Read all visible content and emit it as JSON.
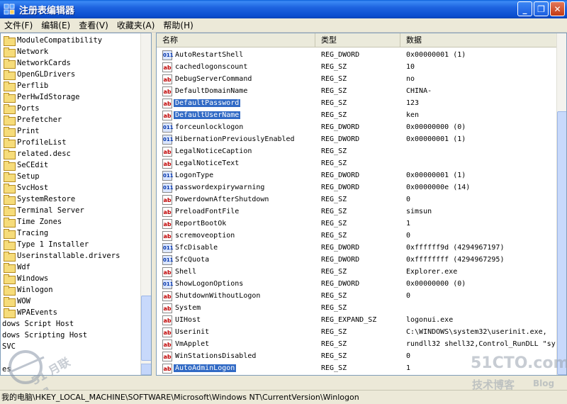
{
  "window": {
    "title": "注册表编辑器"
  },
  "menu": [
    {
      "label": "文件(F)"
    },
    {
      "label": "编辑(E)"
    },
    {
      "label": "查看(V)"
    },
    {
      "label": "收藏夹(A)"
    },
    {
      "label": "帮助(H)"
    }
  ],
  "tree": {
    "items": [
      {
        "label": "ModuleCompatibility",
        "folder": true
      },
      {
        "label": "Network",
        "folder": true
      },
      {
        "label": "NetworkCards",
        "folder": true
      },
      {
        "label": "OpenGLDrivers",
        "folder": true
      },
      {
        "label": "Perflib",
        "folder": true
      },
      {
        "label": "PerHwIdStorage",
        "folder": true
      },
      {
        "label": "Ports",
        "folder": true
      },
      {
        "label": "Prefetcher",
        "folder": true
      },
      {
        "label": "Print",
        "folder": true
      },
      {
        "label": "ProfileList",
        "folder": true
      },
      {
        "label": "related.desc",
        "folder": true
      },
      {
        "label": "SeCEdit",
        "folder": true
      },
      {
        "label": "Setup",
        "folder": true
      },
      {
        "label": "SvcHost",
        "folder": true
      },
      {
        "label": "SystemRestore",
        "folder": true
      },
      {
        "label": "Terminal Server",
        "folder": true
      },
      {
        "label": "Time Zones",
        "folder": true
      },
      {
        "label": "Tracing",
        "folder": true
      },
      {
        "label": "Type 1 Installer",
        "folder": true
      },
      {
        "label": "Userinstallable.drivers",
        "folder": true
      },
      {
        "label": "Wdf",
        "folder": true
      },
      {
        "label": "Windows",
        "folder": true
      },
      {
        "label": "Winlogon",
        "folder": true
      },
      {
        "label": "WOW",
        "folder": true
      },
      {
        "label": "WPAEvents",
        "folder": true
      },
      {
        "label": "dows Script Host",
        "folder": false
      },
      {
        "label": "dows Scripting Host",
        "folder": false
      },
      {
        "label": "SVC",
        "folder": false
      },
      {
        "label": "",
        "folder": false
      },
      {
        "label": "es",
        "folder": false
      }
    ]
  },
  "list": {
    "columns": {
      "name": "名称",
      "type": "类型",
      "data": "数据"
    },
    "rows": [
      {
        "name": "AutoRestartShell",
        "type": "REG_DWORD",
        "data": "0x00000001 (1)",
        "kind": "dw"
      },
      {
        "name": "cachedlogonscount",
        "type": "REG_SZ",
        "data": "10",
        "kind": "sz"
      },
      {
        "name": "DebugServerCommand",
        "type": "REG_SZ",
        "data": "no",
        "kind": "sz"
      },
      {
        "name": "DefaultDomainName",
        "type": "REG_SZ",
        "data": "CHINA-",
        "kind": "sz"
      },
      {
        "name": "DefaultPassword",
        "type": "REG_SZ",
        "data": "123",
        "kind": "sz",
        "selected": true
      },
      {
        "name": "DefaultUserName",
        "type": "REG_SZ",
        "data": "ken",
        "kind": "sz",
        "selected": true
      },
      {
        "name": "forceunlocklogon",
        "type": "REG_DWORD",
        "data": "0x00000000 (0)",
        "kind": "dw"
      },
      {
        "name": "HibernationPreviouslyEnabled",
        "type": "REG_DWORD",
        "data": "0x00000001 (1)",
        "kind": "dw"
      },
      {
        "name": "LegalNoticeCaption",
        "type": "REG_SZ",
        "data": "",
        "kind": "sz"
      },
      {
        "name": "LegalNoticeText",
        "type": "REG_SZ",
        "data": "",
        "kind": "sz"
      },
      {
        "name": "LogonType",
        "type": "REG_DWORD",
        "data": "0x00000001 (1)",
        "kind": "dw"
      },
      {
        "name": "passwordexpirywarning",
        "type": "REG_DWORD",
        "data": "0x0000000e (14)",
        "kind": "dw"
      },
      {
        "name": "PowerdownAfterShutdown",
        "type": "REG_SZ",
        "data": "0",
        "kind": "sz"
      },
      {
        "name": "PreloadFontFile",
        "type": "REG_SZ",
        "data": "simsun",
        "kind": "sz"
      },
      {
        "name": "ReportBootOk",
        "type": "REG_SZ",
        "data": "1",
        "kind": "sz"
      },
      {
        "name": "scremoveoption",
        "type": "REG_SZ",
        "data": "0",
        "kind": "sz"
      },
      {
        "name": "SfcDisable",
        "type": "REG_DWORD",
        "data": "0xffffff9d (4294967197)",
        "kind": "dw"
      },
      {
        "name": "SfcQuota",
        "type": "REG_DWORD",
        "data": "0xffffffff (4294967295)",
        "kind": "dw"
      },
      {
        "name": "Shell",
        "type": "REG_SZ",
        "data": "Explorer.exe",
        "kind": "sz"
      },
      {
        "name": "ShowLogonOptions",
        "type": "REG_DWORD",
        "data": "0x00000000 (0)",
        "kind": "dw"
      },
      {
        "name": "ShutdownWithoutLogon",
        "type": "REG_SZ",
        "data": "0",
        "kind": "sz"
      },
      {
        "name": "System",
        "type": "REG_SZ",
        "data": "",
        "kind": "sz"
      },
      {
        "name": "UIHost",
        "type": "REG_EXPAND_SZ",
        "data": "logonui.exe",
        "kind": "sz"
      },
      {
        "name": "Userinit",
        "type": "REG_SZ",
        "data": "C:\\WINDOWS\\system32\\userinit.exe,",
        "kind": "sz"
      },
      {
        "name": "VmApplet",
        "type": "REG_SZ",
        "data": "rundll32 shell32,Control_RunDLL \"sy",
        "kind": "sz"
      },
      {
        "name": "WinStationsDisabled",
        "type": "REG_SZ",
        "data": "0",
        "kind": "sz"
      },
      {
        "name": "AutoAdminLogon",
        "type": "REG_SZ",
        "data": "1",
        "kind": "sz",
        "selected": true
      }
    ]
  },
  "status": {
    "path": "我的电脑\\HKEY_LOCAL_MACHINE\\SOFTWARE\\Microsoft\\Windows NT\\CurrentVersion\\Winlogon"
  },
  "watermarks": {
    "left": "51 月联盟",
    "right_main": "51CTO.com",
    "right_sub": "技术博客",
    "right_blog": "Blog"
  },
  "colors": {
    "selection": "#316ac5",
    "titlebar": "#0b4fd0",
    "sz_icon": "#c00000",
    "dword_icon": "#0033aa"
  }
}
